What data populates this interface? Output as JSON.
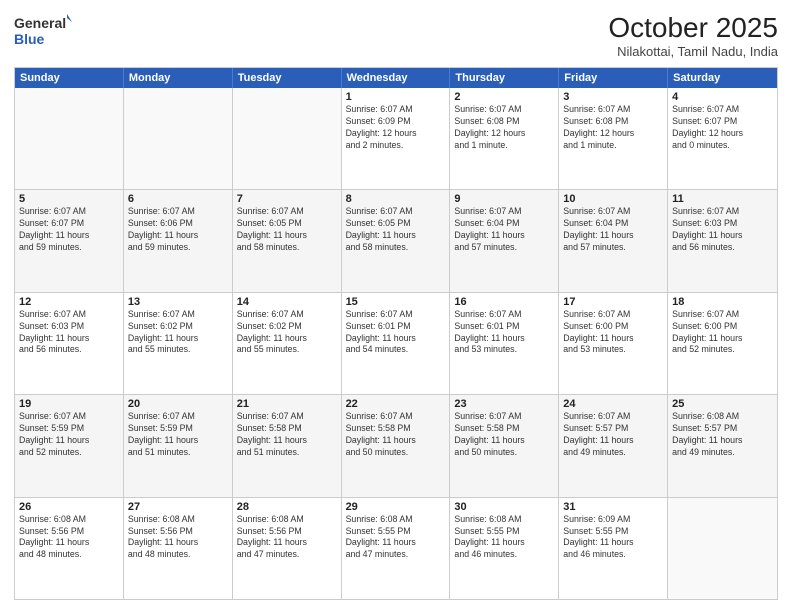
{
  "logo": {
    "line1": "General",
    "line2": "Blue"
  },
  "title": "October 2025",
  "location": "Nilakottai, Tamil Nadu, India",
  "weekdays": [
    "Sunday",
    "Monday",
    "Tuesday",
    "Wednesday",
    "Thursday",
    "Friday",
    "Saturday"
  ],
  "weeks": [
    [
      {
        "day": "",
        "info": ""
      },
      {
        "day": "",
        "info": ""
      },
      {
        "day": "",
        "info": ""
      },
      {
        "day": "1",
        "info": "Sunrise: 6:07 AM\nSunset: 6:09 PM\nDaylight: 12 hours\nand 2 minutes."
      },
      {
        "day": "2",
        "info": "Sunrise: 6:07 AM\nSunset: 6:08 PM\nDaylight: 12 hours\nand 1 minute."
      },
      {
        "day": "3",
        "info": "Sunrise: 6:07 AM\nSunset: 6:08 PM\nDaylight: 12 hours\nand 1 minute."
      },
      {
        "day": "4",
        "info": "Sunrise: 6:07 AM\nSunset: 6:07 PM\nDaylight: 12 hours\nand 0 minutes."
      }
    ],
    [
      {
        "day": "5",
        "info": "Sunrise: 6:07 AM\nSunset: 6:07 PM\nDaylight: 11 hours\nand 59 minutes."
      },
      {
        "day": "6",
        "info": "Sunrise: 6:07 AM\nSunset: 6:06 PM\nDaylight: 11 hours\nand 59 minutes."
      },
      {
        "day": "7",
        "info": "Sunrise: 6:07 AM\nSunset: 6:05 PM\nDaylight: 11 hours\nand 58 minutes."
      },
      {
        "day": "8",
        "info": "Sunrise: 6:07 AM\nSunset: 6:05 PM\nDaylight: 11 hours\nand 58 minutes."
      },
      {
        "day": "9",
        "info": "Sunrise: 6:07 AM\nSunset: 6:04 PM\nDaylight: 11 hours\nand 57 minutes."
      },
      {
        "day": "10",
        "info": "Sunrise: 6:07 AM\nSunset: 6:04 PM\nDaylight: 11 hours\nand 57 minutes."
      },
      {
        "day": "11",
        "info": "Sunrise: 6:07 AM\nSunset: 6:03 PM\nDaylight: 11 hours\nand 56 minutes."
      }
    ],
    [
      {
        "day": "12",
        "info": "Sunrise: 6:07 AM\nSunset: 6:03 PM\nDaylight: 11 hours\nand 56 minutes."
      },
      {
        "day": "13",
        "info": "Sunrise: 6:07 AM\nSunset: 6:02 PM\nDaylight: 11 hours\nand 55 minutes."
      },
      {
        "day": "14",
        "info": "Sunrise: 6:07 AM\nSunset: 6:02 PM\nDaylight: 11 hours\nand 55 minutes."
      },
      {
        "day": "15",
        "info": "Sunrise: 6:07 AM\nSunset: 6:01 PM\nDaylight: 11 hours\nand 54 minutes."
      },
      {
        "day": "16",
        "info": "Sunrise: 6:07 AM\nSunset: 6:01 PM\nDaylight: 11 hours\nand 53 minutes."
      },
      {
        "day": "17",
        "info": "Sunrise: 6:07 AM\nSunset: 6:00 PM\nDaylight: 11 hours\nand 53 minutes."
      },
      {
        "day": "18",
        "info": "Sunrise: 6:07 AM\nSunset: 6:00 PM\nDaylight: 11 hours\nand 52 minutes."
      }
    ],
    [
      {
        "day": "19",
        "info": "Sunrise: 6:07 AM\nSunset: 5:59 PM\nDaylight: 11 hours\nand 52 minutes."
      },
      {
        "day": "20",
        "info": "Sunrise: 6:07 AM\nSunset: 5:59 PM\nDaylight: 11 hours\nand 51 minutes."
      },
      {
        "day": "21",
        "info": "Sunrise: 6:07 AM\nSunset: 5:58 PM\nDaylight: 11 hours\nand 51 minutes."
      },
      {
        "day": "22",
        "info": "Sunrise: 6:07 AM\nSunset: 5:58 PM\nDaylight: 11 hours\nand 50 minutes."
      },
      {
        "day": "23",
        "info": "Sunrise: 6:07 AM\nSunset: 5:58 PM\nDaylight: 11 hours\nand 50 minutes."
      },
      {
        "day": "24",
        "info": "Sunrise: 6:07 AM\nSunset: 5:57 PM\nDaylight: 11 hours\nand 49 minutes."
      },
      {
        "day": "25",
        "info": "Sunrise: 6:08 AM\nSunset: 5:57 PM\nDaylight: 11 hours\nand 49 minutes."
      }
    ],
    [
      {
        "day": "26",
        "info": "Sunrise: 6:08 AM\nSunset: 5:56 PM\nDaylight: 11 hours\nand 48 minutes."
      },
      {
        "day": "27",
        "info": "Sunrise: 6:08 AM\nSunset: 5:56 PM\nDaylight: 11 hours\nand 48 minutes."
      },
      {
        "day": "28",
        "info": "Sunrise: 6:08 AM\nSunset: 5:56 PM\nDaylight: 11 hours\nand 47 minutes."
      },
      {
        "day": "29",
        "info": "Sunrise: 6:08 AM\nSunset: 5:55 PM\nDaylight: 11 hours\nand 47 minutes."
      },
      {
        "day": "30",
        "info": "Sunrise: 6:08 AM\nSunset: 5:55 PM\nDaylight: 11 hours\nand 46 minutes."
      },
      {
        "day": "31",
        "info": "Sunrise: 6:09 AM\nSunset: 5:55 PM\nDaylight: 11 hours\nand 46 minutes."
      },
      {
        "day": "",
        "info": ""
      }
    ]
  ]
}
